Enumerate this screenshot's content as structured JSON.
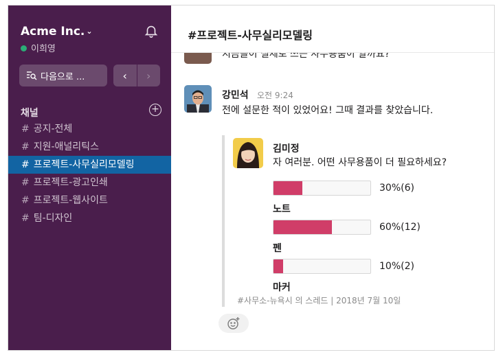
{
  "workspace": {
    "name": "Acme Inc.",
    "user_status": "이희영"
  },
  "search": {
    "placeholder": "다음으로 ..."
  },
  "sidebar": {
    "section_title": "채널",
    "channels": [
      {
        "name": "공지-전체",
        "active": false
      },
      {
        "name": "지원-애널리틱스",
        "active": false
      },
      {
        "name": "프로젝트-사무실리모델링",
        "active": true
      },
      {
        "name": "프로젝트-광고인쇄",
        "active": false
      },
      {
        "name": "프로젝트-웹사이트",
        "active": false
      },
      {
        "name": "팀-디자인",
        "active": false
      }
    ]
  },
  "channel": {
    "title": "#프로젝트-사무실리모델링"
  },
  "prev_message": {
    "text": "지금들이 실제로 쓰는 사무용품이 알까요?"
  },
  "message": {
    "author": "강민석",
    "time": "오전 9:24",
    "text": "전에 설문한 적이 있었어요! 그때 결과를 찾았습니다."
  },
  "quoted": {
    "author": "김미정",
    "text": "자 여러분. 어떤 사무용품이 더 필요하세요?",
    "poll": [
      {
        "label": "노트",
        "pct_label": "30%(6)",
        "pct": 0.3
      },
      {
        "label": "펜",
        "pct_label": "60%(12)",
        "pct": 0.6
      },
      {
        "label": "마커",
        "pct_label": "10%(2)",
        "pct": 0.1
      }
    ],
    "footer": "#사무소-뉴욕시 의 스레드 | 2018년 7월 10일"
  },
  "colors": {
    "sidebar": "#4a1e4c",
    "active": "#1264a3",
    "poll_fill": "#d03d68",
    "presence": "#2bac76"
  }
}
